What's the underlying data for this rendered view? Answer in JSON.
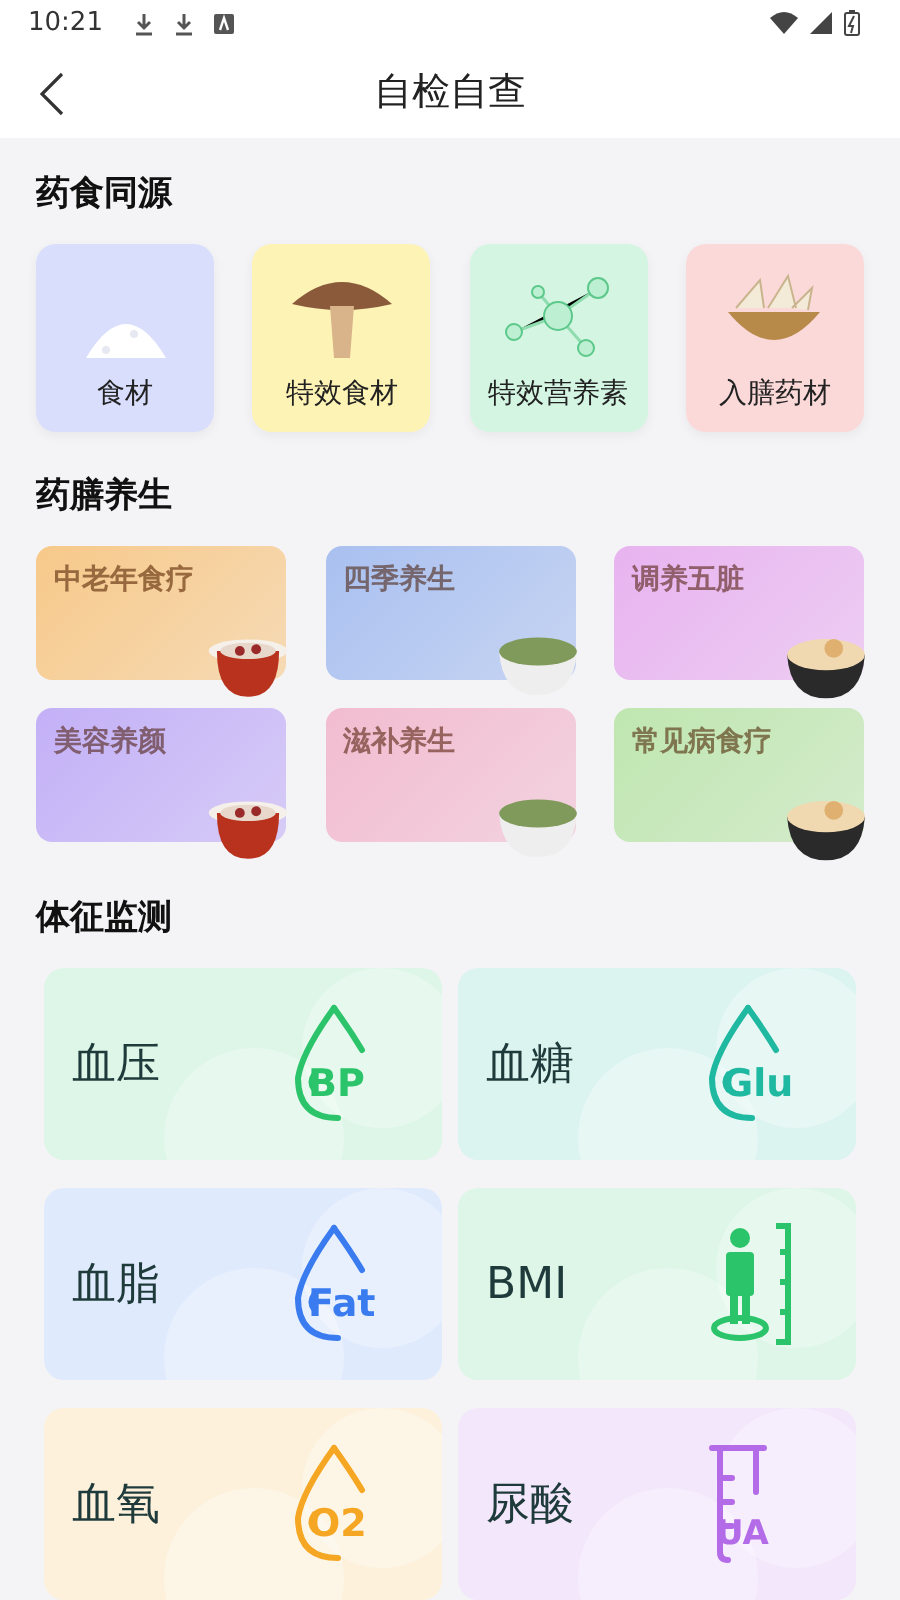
{
  "status_bar": {
    "time": "10:21"
  },
  "header": {
    "title": "自检自查"
  },
  "sections": [
    {
      "title": "药食同源"
    },
    {
      "title": "药膳养生"
    },
    {
      "title": "体征监测"
    }
  ],
  "origin_tiles": [
    {
      "label": "食材",
      "kind": "pile",
      "color": "#d9defc"
    },
    {
      "label": "特效食材",
      "kind": "mushroom",
      "color": "#fdf3b5"
    },
    {
      "label": "特效营养素",
      "kind": "molecule",
      "color": "#d3f5e2"
    },
    {
      "label": "入膳药材",
      "kind": "herb",
      "color": "#fcd9d9"
    }
  ],
  "diet_cards": [
    {
      "label": "中老年食疗",
      "color": "#f7c98a",
      "kind": "pot"
    },
    {
      "label": "四季养生",
      "color": "#a9c0f0",
      "kind": "bowl"
    },
    {
      "label": "调养五脏",
      "color": "#e8b3f0",
      "kind": "soup"
    },
    {
      "label": "美容养颜",
      "color": "#c3b0f7",
      "kind": "pot"
    },
    {
      "label": "滋补养生",
      "color": "#f2bcd0",
      "kind": "bowl"
    },
    {
      "label": "常见病食疗",
      "color": "#bfe6b0",
      "kind": "soup"
    }
  ],
  "health_cards": [
    {
      "label": "血压",
      "icon_text": "BP",
      "kind": "drop",
      "color": "#2cc46a"
    },
    {
      "label": "血糖",
      "icon_text": "Glu",
      "kind": "drop",
      "color": "#1fb8a0"
    },
    {
      "label": "血脂",
      "icon_text": "Fat",
      "kind": "drop",
      "color": "#3a7cf0"
    },
    {
      "label": "BMI",
      "kind": "person",
      "color": "#2cc46a"
    },
    {
      "label": "血氧",
      "icon_text": "O2",
      "kind": "drop",
      "color": "#f5a623"
    },
    {
      "label": "尿酸",
      "icon_text": "UA",
      "kind": "tube",
      "color": "#b36be8"
    }
  ]
}
